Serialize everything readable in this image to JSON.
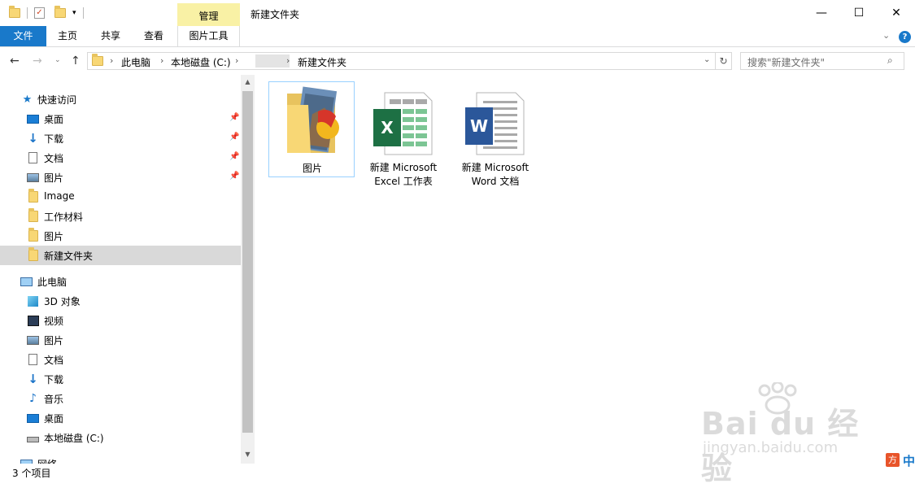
{
  "titlebar": {
    "context_tab": "管理",
    "window_title": "新建文件夹",
    "minimize": "—",
    "maximize": "☐",
    "close": "✕"
  },
  "ribbon": {
    "tabs": [
      "文件",
      "主页",
      "共享",
      "查看",
      "图片工具"
    ],
    "expand_icon": "chevron-down-icon",
    "help_glyph": "?"
  },
  "address": {
    "crumbs": [
      "此电脑",
      "本地磁盘 (C:)",
      "新建文件夹"
    ],
    "search_placeholder": "搜索\"新建文件夹\""
  },
  "sidebar": {
    "quick_access": "快速访问",
    "quick_items": [
      "桌面",
      "下载",
      "文档",
      "图片",
      "Image",
      "工作材料",
      "图片",
      "新建文件夹"
    ],
    "this_pc": "此电脑",
    "pc_items": [
      "3D 对象",
      "视频",
      "图片",
      "文档",
      "下载",
      "音乐",
      "桌面",
      "本地磁盘 (C:)"
    ],
    "network": "网络"
  },
  "files": [
    {
      "line1": "图片",
      "line2": ""
    },
    {
      "line1": "新建 Microsoft",
      "line2": "Excel 工作表"
    },
    {
      "line1": "新建 Microsoft",
      "line2": "Word 文档"
    }
  ],
  "status": {
    "count": "3 个项目"
  },
  "watermark": {
    "main": "Bai du 经验",
    "sub": "jingyan.baidu.com"
  },
  "ime": {
    "label": "中"
  },
  "colors": {
    "accent": "#1979ca",
    "context_tab": "#f9f1a5",
    "selected": "#d9d9d9",
    "excel": "#1d7044",
    "word": "#2b579a"
  }
}
